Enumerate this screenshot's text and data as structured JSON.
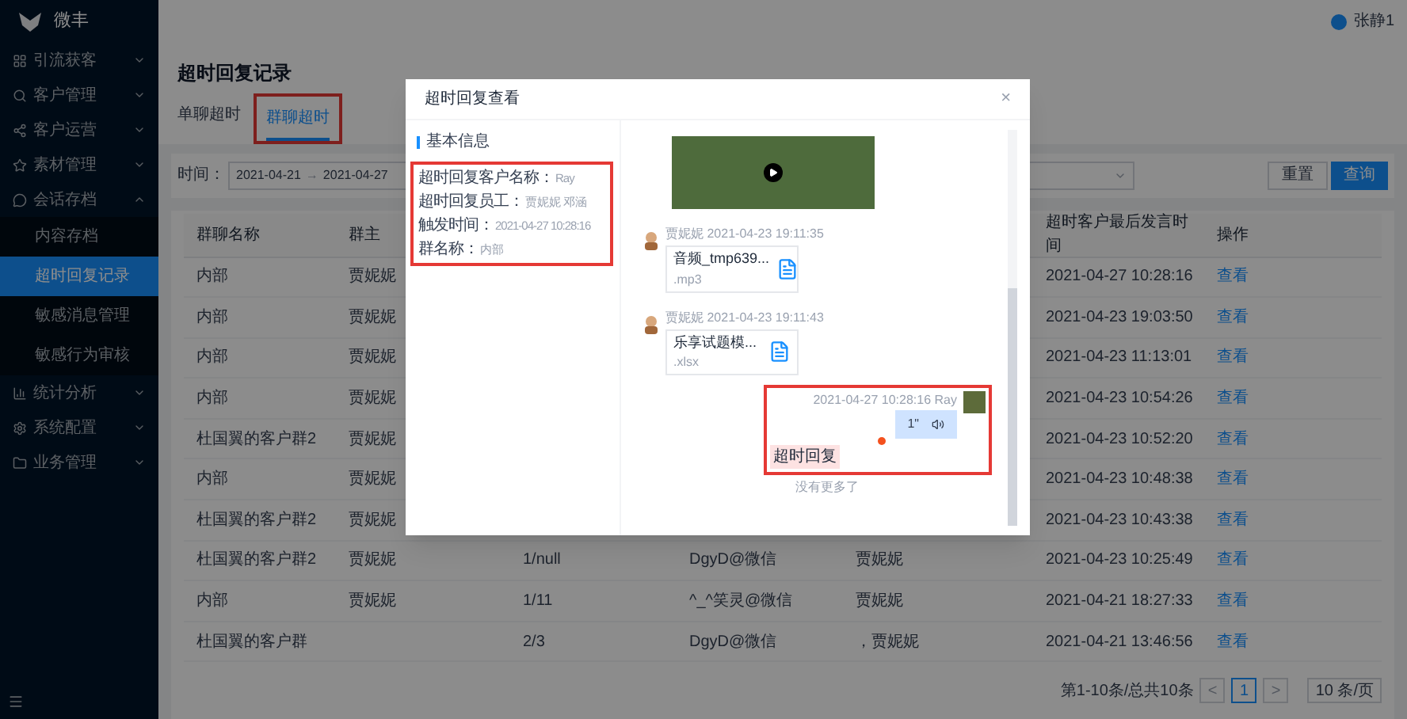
{
  "sidebar": {
    "logo": "微丰",
    "items": [
      {
        "label": "引流获客",
        "expanded": false
      },
      {
        "label": "客户管理",
        "expanded": false
      },
      {
        "label": "客户运营",
        "expanded": false
      },
      {
        "label": "素材管理",
        "expanded": false
      },
      {
        "label": "会话存档",
        "expanded": true,
        "children": [
          {
            "label": "内容存档",
            "selected": false
          },
          {
            "label": "超时回复记录",
            "selected": true
          },
          {
            "label": "敏感消息管理",
            "selected": false
          },
          {
            "label": "敏感行为审核",
            "selected": false
          }
        ]
      },
      {
        "label": "统计分析",
        "expanded": false
      },
      {
        "label": "系统配置",
        "expanded": false
      },
      {
        "label": "业务管理",
        "expanded": false
      }
    ]
  },
  "header": {
    "user": "张静1"
  },
  "page_title": "超时回复记录",
  "tabs": [
    {
      "label": "单聊超时",
      "selected": false,
      "highlighted": false
    },
    {
      "label": "群聊超时",
      "selected": true,
      "highlighted": true
    }
  ],
  "filter": {
    "label": "时间：",
    "start": "2021-04-21",
    "separator": "→",
    "end": "2021-04-27",
    "buttons": [
      {
        "label": "重置",
        "primary": false
      },
      {
        "label": "查询",
        "primary": true
      }
    ]
  },
  "table": {
    "columns": [
      "群聊名称",
      "群主",
      "",
      "",
      "",
      "超时客户最后发言时间",
      "操作"
    ],
    "rows": [
      [
        "内部",
        "贾妮妮",
        "",
        "",
        "",
        "2021-04-27 10:28:16",
        "查看"
      ],
      [
        "内部",
        "贾妮妮",
        "",
        "",
        "",
        "2021-04-23 19:03:50",
        "查看"
      ],
      [
        "内部",
        "贾妮妮",
        "",
        "",
        "",
        "2021-04-23 11:13:01",
        "查看"
      ],
      [
        "内部",
        "贾妮妮",
        "",
        "",
        "",
        "2021-04-23 10:54:26",
        "查看"
      ],
      [
        "杜国翼的客户群2",
        "贾妮妮",
        "",
        "",
        "",
        "2021-04-23 10:52:20",
        "查看"
      ],
      [
        "内部",
        "贾妮妮",
        "",
        "",
        "",
        "2021-04-23 10:48:38",
        "查看"
      ],
      [
        "杜国翼的客户群2",
        "贾妮妮",
        "",
        "",
        "",
        "2021-04-23 10:43:38",
        "查看"
      ],
      [
        "杜国翼的客户群2",
        "贾妮妮",
        "1/null",
        "DgyD@微信",
        "贾妮妮",
        "2021-04-23 10:25:49",
        "查看"
      ],
      [
        "内部",
        "贾妮妮",
        "1/11",
        "^_^笑灵@微信",
        "贾妮妮",
        "2021-04-21 18:27:33",
        "查看"
      ],
      [
        "杜国翼的客户群",
        "",
        "2/3",
        "DgyD@微信",
        "，贾妮妮",
        "2021-04-21 13:46:56",
        "查看"
      ]
    ]
  },
  "pagination": {
    "summary": "第1-10条/总共10条",
    "prev": "<",
    "pages": [
      {
        "label": "1",
        "selected": true
      }
    ],
    "next": ">",
    "page_size": "10 条/页"
  },
  "modal": {
    "title": "超时回复查看",
    "close": "×",
    "info": {
      "heading": "基本信息",
      "highlighted": true,
      "fields": [
        {
          "label": "超时回复客户名称：",
          "value": "Ray"
        },
        {
          "label": "超时回复员工：",
          "value": "贾妮妮 邓涵"
        },
        {
          "label": "触发时间：",
          "value": "2021-04-27 10:28:16"
        },
        {
          "label": "群名称：",
          "value": "内部"
        }
      ]
    },
    "messages": [
      {
        "kind": "video",
        "highlighted": false
      },
      {
        "kind": "file",
        "sender": "贾妮妮",
        "time": "2021-04-23 19:11:35",
        "name": "音频_tmp639...",
        "ext": ".mp3",
        "highlighted": false
      },
      {
        "kind": "file",
        "sender": "贾妮妮",
        "time": "2021-04-23 19:11:43",
        "name": "乐享试题模...",
        "ext": ".xlsx",
        "highlighted": false
      },
      {
        "kind": "voice",
        "sender": "Ray",
        "time": "2021-04-27 10:28:16",
        "duration": "1\"",
        "tag": "超时回复",
        "unread": true,
        "highlighted": true
      }
    ],
    "end_note": "没有更多了"
  }
}
